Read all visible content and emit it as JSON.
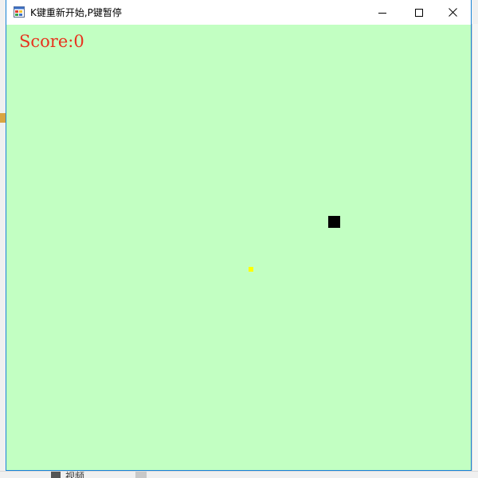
{
  "window": {
    "title": "K键重新开始,P键暂停"
  },
  "game": {
    "score_label": "Score:0",
    "score": 0,
    "background_color": "#c2ffc2",
    "snake_color": "#000000",
    "food_color": "#ffff00",
    "score_color": "#e8321e"
  },
  "background_window": {
    "bottom_label": "视频"
  },
  "icons": {
    "app": "app-window-icon",
    "minimize": "minimize-icon",
    "maximize": "maximize-icon",
    "close": "close-icon"
  }
}
